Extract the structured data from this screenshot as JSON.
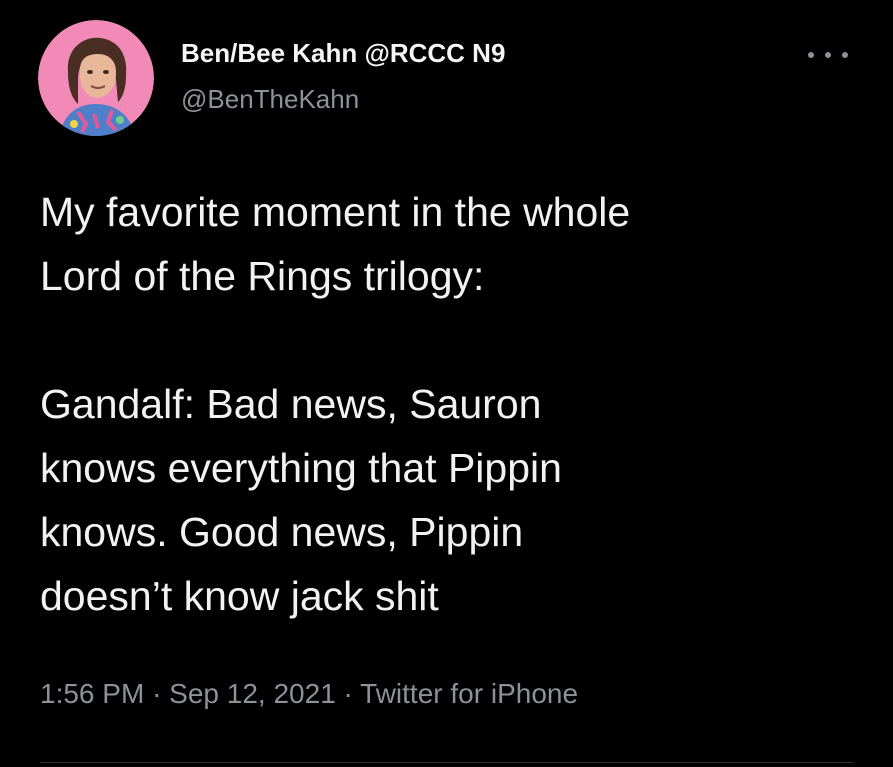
{
  "author": {
    "display_name": "Ben/Bee Kahn @RCCC N9",
    "handle": "@BenTheKahn",
    "avatar_icon": "illustrated-portrait"
  },
  "tweet": {
    "text": "My favorite moment in the whole\nLord of the Rings trilogy:\n\nGandalf: Bad news, Sauron\nknows everything that Pippin\nknows. Good news, Pippin\ndoesn’t know jack shit"
  },
  "meta": {
    "time": "1:56 PM",
    "separator": "·",
    "date": "Sep 12, 2021",
    "source": "Twitter for iPhone"
  },
  "icons": {
    "more": "more-horizontal-icon"
  },
  "colors": {
    "background": "#000000",
    "text": "#f2f2f2",
    "secondary": "#8b9298",
    "avatar_bg": "#f28ab8"
  }
}
